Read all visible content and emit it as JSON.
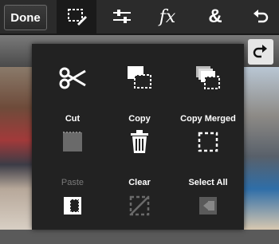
{
  "toolbar": {
    "done_label": "Done",
    "fx_label": "fx",
    "amp_label": "&"
  },
  "menu": {
    "items": [
      {
        "label": "Cut",
        "icon": "scissors-icon",
        "enabled": true
      },
      {
        "label": "Copy",
        "icon": "copy-icon",
        "enabled": true
      },
      {
        "label": "Copy Merged",
        "icon": "copy-merged-icon",
        "enabled": true
      },
      {
        "label": "Paste",
        "icon": "paste-icon",
        "enabled": false
      },
      {
        "label": "Clear",
        "icon": "trash-icon",
        "enabled": true
      },
      {
        "label": "Select All",
        "icon": "select-all-icon",
        "enabled": true
      },
      {
        "label": "",
        "icon": "invert-selection-icon",
        "enabled": true
      },
      {
        "label": "",
        "icon": "deselect-icon",
        "enabled": false
      },
      {
        "label": "",
        "icon": "fill-selection-icon",
        "enabled": false
      }
    ]
  }
}
